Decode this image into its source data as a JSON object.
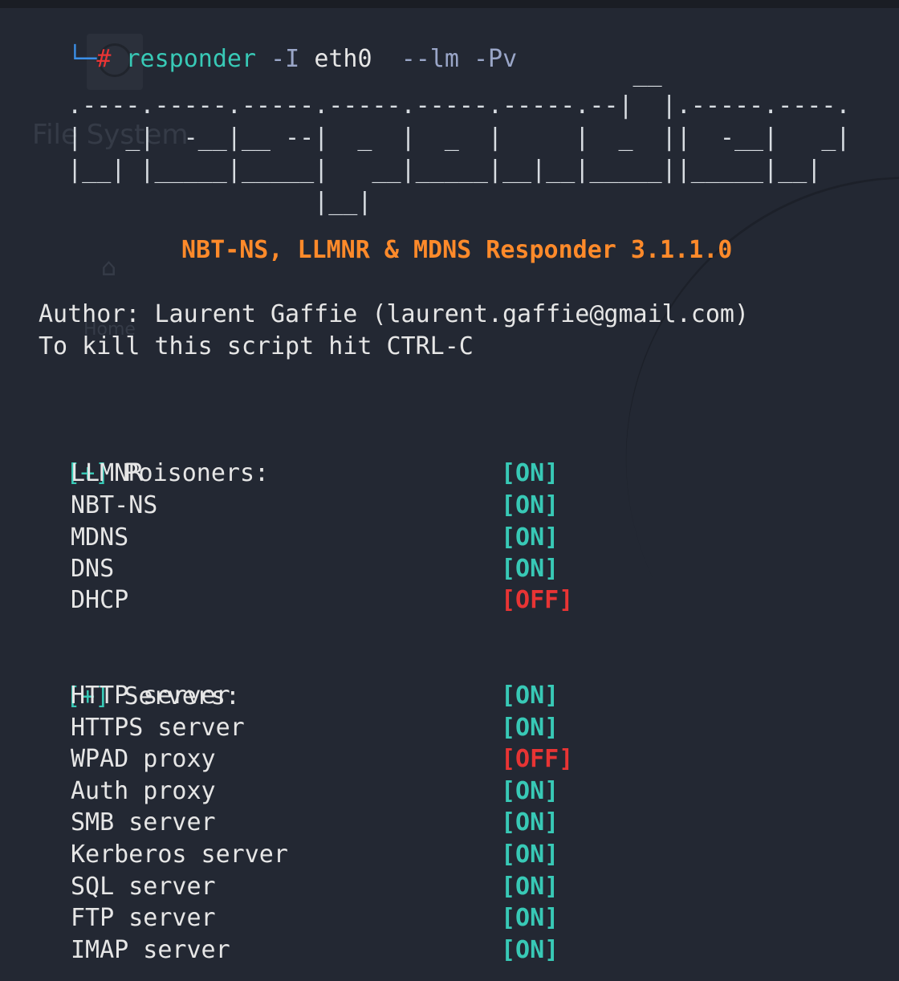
{
  "prompt": {
    "corner": "└─",
    "hash": "#",
    "command": "responder",
    "flag_i": "-I",
    "iface": "eth0",
    "flags": "--lm -Pv"
  },
  "banner": {
    "ascii": "                                         __\n  .----.-----.-----.-----.-----.-----.--|  |.-----.----.\n  |   _|  -__|__ --|  _  |  _  |     |  _  ||  -__|   _|\n  |__| |_____|_____|   __|_____|__|__|_____||_____|__|\n                   |__|",
    "title": "NBT-NS, LLMNR & MDNS Responder 3.1.1.0",
    "author": "Author: Laurent Gaffie (laurent.gaffie@gmail.com)",
    "kill_hint": "To kill this script hit CTRL-C"
  },
  "poisoners": {
    "marker": "[+]",
    "heading": "Poisoners:",
    "items": [
      {
        "name": "LLMNR",
        "status": "[ON]",
        "on": true
      },
      {
        "name": "NBT-NS",
        "status": "[ON]",
        "on": true
      },
      {
        "name": "MDNS",
        "status": "[ON]",
        "on": true
      },
      {
        "name": "DNS",
        "status": "[ON]",
        "on": true
      },
      {
        "name": "DHCP",
        "status": "[OFF]",
        "on": false
      }
    ]
  },
  "servers": {
    "marker": "[+]",
    "heading": "Servers:",
    "items": [
      {
        "name": "HTTP server",
        "status": "[ON]",
        "on": true
      },
      {
        "name": "HTTPS server",
        "status": "[ON]",
        "on": true
      },
      {
        "name": "WPAD proxy",
        "status": "[OFF]",
        "on": false
      },
      {
        "name": "Auth proxy",
        "status": "[ON]",
        "on": true
      },
      {
        "name": "SMB server",
        "status": "[ON]",
        "on": true
      },
      {
        "name": "Kerberos server",
        "status": "[ON]",
        "on": true
      },
      {
        "name": "SQL server",
        "status": "[ON]",
        "on": true
      },
      {
        "name": "FTP server",
        "status": "[ON]",
        "on": true
      },
      {
        "name": "IMAP server",
        "status": "[ON]",
        "on": true
      }
    ]
  },
  "desktop_ghost": {
    "file_system_label": "File System",
    "home_label": "Home"
  },
  "colors": {
    "on": "#38c9b6",
    "off": "#e83434",
    "title": "#ff8a2a",
    "background": "#232833"
  }
}
